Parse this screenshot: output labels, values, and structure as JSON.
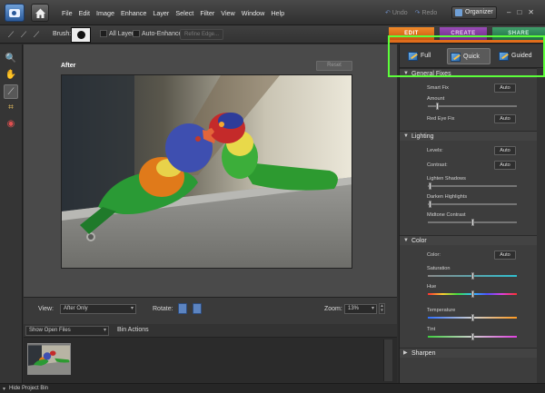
{
  "menu": [
    "File",
    "Edit",
    "Image",
    "Enhance",
    "Layer",
    "Select",
    "Filter",
    "View",
    "Window",
    "Help"
  ],
  "history": {
    "undo": "Undo",
    "redo": "Redo"
  },
  "organizer": "Organizer",
  "window_controls": {
    "minimize": "–",
    "maximize": "□",
    "close": "✕"
  },
  "options": {
    "brush_label": "Brush:",
    "all_layers": "All Layers",
    "auto_enhance": "Auto-Enhance",
    "refine_edge": "Refine Edge..."
  },
  "tabs": {
    "edit": "EDIT",
    "create": "CREATE",
    "share": "SHARE"
  },
  "modes": {
    "full": "Full",
    "quick": "Quick",
    "guided": "Guided",
    "active": "Quick"
  },
  "canvas": {
    "view_label": "After",
    "reset": "Reset"
  },
  "bottom": {
    "view_label": "View:",
    "view_value": "After Only",
    "rotate_label": "Rotate:",
    "zoom_label": "Zoom:",
    "zoom_value": "13%"
  },
  "bin": {
    "show": "Show Open Files",
    "actions": "Bin Actions",
    "hide": "Hide Project Bin"
  },
  "panel": {
    "general": {
      "title": "General Fixes",
      "smart_fix": "Smart Fix",
      "amount": "Amount",
      "red_eye": "Red Eye Fix",
      "auto": "Auto"
    },
    "lighting": {
      "title": "Lighting",
      "levels": "Levels:",
      "contrast": "Contrast:",
      "lighten": "Lighten Shadows",
      "darken": "Darken Highlights",
      "midtone": "Midtone Contrast",
      "auto": "Auto"
    },
    "color": {
      "title": "Color",
      "color": "Color:",
      "saturation": "Saturation",
      "hue": "Hue",
      "temperature": "Temperature",
      "tint": "Tint",
      "auto": "Auto"
    },
    "sharpen": {
      "title": "Sharpen"
    }
  },
  "colors": {
    "accent_edit": "#e06d1c",
    "accent_create": "#7a3494",
    "accent_share": "#2a8a56",
    "highlight_box": "#5cff3a"
  }
}
